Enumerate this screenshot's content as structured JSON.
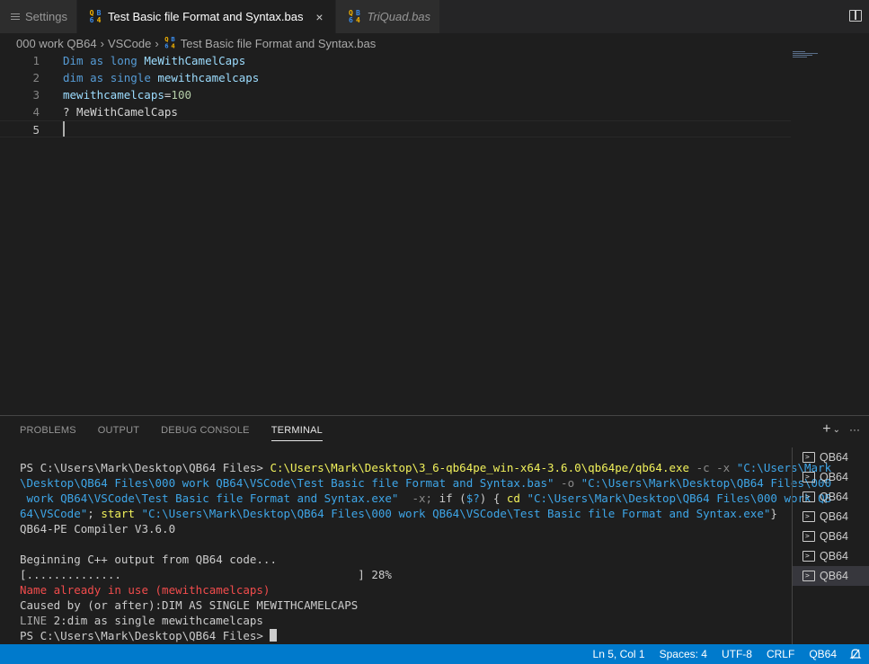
{
  "tabs": [
    {
      "label": "Settings",
      "icon": "settings-lines-icon",
      "active": false
    },
    {
      "label": "Test Basic file Format and Syntax.bas",
      "icon": "qb64-icon",
      "active": true,
      "close": "×"
    },
    {
      "label": "TriQuad.bas",
      "icon": "qb64-icon",
      "active": false
    }
  ],
  "qb_icon": {
    "q": "Q",
    "b": "B",
    "six": "6",
    "four": "4"
  },
  "breadcrumb": [
    "000 work QB64",
    "VSCode",
    "Test Basic file Format and Syntax.bas"
  ],
  "breadcrumb_sep": "›",
  "editor": {
    "line_numbers": [
      "1",
      "2",
      "3",
      "4",
      "5"
    ],
    "lines": [
      [
        {
          "t": "Dim",
          "c": "kw"
        },
        {
          "t": " ",
          "c": "plain"
        },
        {
          "t": "as",
          "c": "kw"
        },
        {
          "t": " ",
          "c": "plain"
        },
        {
          "t": "long",
          "c": "kw"
        },
        {
          "t": " MeWithCamelCaps",
          "c": "id"
        }
      ],
      [
        {
          "t": "dim",
          "c": "kw"
        },
        {
          "t": " ",
          "c": "plain"
        },
        {
          "t": "as",
          "c": "kw"
        },
        {
          "t": " ",
          "c": "plain"
        },
        {
          "t": "single",
          "c": "kw"
        },
        {
          "t": " mewithcamelcaps",
          "c": "id"
        }
      ],
      [
        {
          "t": "mewithcamelcaps",
          "c": "id"
        },
        {
          "t": "=",
          "c": "plain"
        },
        {
          "t": "100",
          "c": "num-lit"
        }
      ],
      [
        {
          "t": "? MeWithCamelCaps",
          "c": "plain"
        }
      ],
      []
    ]
  },
  "panel": {
    "tabs": [
      "PROBLEMS",
      "OUTPUT",
      "DEBUG CONSOLE",
      "TERMINAL"
    ],
    "active_tab": "TERMINAL",
    "actions": {
      "add": "+",
      "chevron": "⌄",
      "more": "···"
    }
  },
  "terminal": {
    "lines": [
      [
        {
          "t": "PS C:\\Users\\Mark\\Desktop\\QB64 Files> ",
          "c": ""
        },
        {
          "t": "C:\\Users\\Mark\\Desktop\\3_6-qb64pe_win-x64-3.6.0\\qb64pe/qb64.exe",
          "c": "t-exe"
        },
        {
          "t": " -c -x ",
          "c": "t-flag"
        },
        {
          "t": "\"C:\\Users\\Mark",
          "c": "t-str"
        }
      ],
      [
        {
          "t": "\\Desktop\\QB64 Files\\000 work QB64\\VSCode\\Test Basic file Format and Syntax.bas\"",
          "c": "t-str"
        },
        {
          "t": " -o ",
          "c": "t-flag"
        },
        {
          "t": "\"C:\\Users\\Mark\\Desktop\\QB64 Files\\000",
          "c": "t-str"
        }
      ],
      [
        {
          "t": " work QB64\\VSCode\\Test Basic file Format and Syntax.exe\"",
          "c": "t-str"
        },
        {
          "t": "  -x; ",
          "c": "t-flag"
        },
        {
          "t": "if",
          "c": ""
        },
        {
          "t": " (",
          "c": ""
        },
        {
          "t": "$?",
          "c": "t-str"
        },
        {
          "t": ") { ",
          "c": ""
        },
        {
          "t": "cd",
          "c": "t-kw"
        },
        {
          "t": " \"C:\\Users\\Mark\\Desktop\\QB64 Files\\000 work QB",
          "c": "t-str"
        }
      ],
      [
        {
          "t": "64\\VSCode\"",
          "c": "t-str"
        },
        {
          "t": "; ",
          "c": ""
        },
        {
          "t": "start",
          "c": "t-kw"
        },
        {
          "t": " \"C:\\Users\\Mark\\Desktop\\QB64 Files\\000 work QB64\\VSCode\\Test Basic file Format and Syntax.exe\"",
          "c": "t-str"
        },
        {
          "t": "}",
          "c": ""
        }
      ],
      [
        {
          "t": "QB64-PE Compiler V3.6.0",
          "c": ""
        }
      ],
      [
        {
          "t": " ",
          "c": ""
        }
      ],
      [
        {
          "t": "Beginning C++ output from QB64 code...",
          "c": ""
        }
      ],
      [
        {
          "t": "[..............                                   ] 28%",
          "c": ""
        }
      ],
      [
        {
          "t": "Name already in use (mewithcamelcaps)",
          "c": "t-err"
        }
      ],
      [
        {
          "t": "Caused by (or after):DIM AS SINGLE MEWITHCAMELCAPS",
          "c": ""
        }
      ],
      [
        {
          "t": "LINE ",
          "c": "t-gray"
        },
        {
          "t": "2:dim as single mewithcamelcaps",
          "c": ""
        }
      ],
      [
        {
          "t": "PS C:\\Users\\Mark\\Desktop\\QB64 Files> ",
          "c": ""
        }
      ]
    ],
    "sessions": [
      "QB64",
      "QB64",
      "QB64",
      "QB64",
      "QB64",
      "QB64",
      "QB64"
    ],
    "active_session": 6
  },
  "statusbar": {
    "position": "Ln 5, Col 1",
    "indent": "Spaces: 4",
    "encoding": "UTF-8",
    "eol": "CRLF",
    "language": "QB64"
  }
}
